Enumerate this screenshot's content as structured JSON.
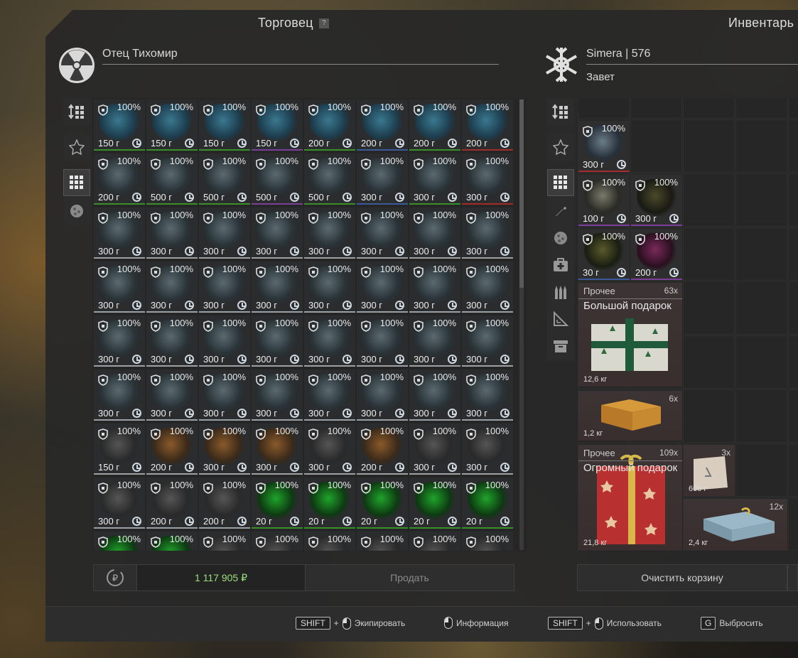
{
  "trader": {
    "section_title": "Торговец",
    "help": "?",
    "name": "Отец Тихомир",
    "icon": "radiation-icon"
  },
  "inventory": {
    "section_title": "Инвентарь",
    "player": "Simera | 576",
    "faction": "Завет",
    "icon": "faction-emblem-icon"
  },
  "trader_sidebar": [
    "sort-icon",
    "star-icon",
    "grid-icon",
    "artifact-icon"
  ],
  "inventory_sidebar": [
    "sort-icon",
    "star-icon",
    "grid-icon",
    "weapon-icon",
    "artifact-icon",
    "medkit-icon",
    "ammo-icon",
    "tools-icon",
    "box-icon"
  ],
  "colors": {
    "accent_green": "#9be07a",
    "rarity_green": "#3b8f2a",
    "rarity_purple": "#7b3f9a",
    "rarity_red": "#a22b2b",
    "rarity_blue": "#3a5a9a"
  },
  "trader_items": [
    [
      "100%",
      "150 г",
      "100%",
      "150 г",
      "100%",
      "150 г",
      "100%",
      "150 г",
      "100%",
      "200 г",
      "100%",
      "200 г",
      "100%",
      "200 г",
      "100%",
      "200 г"
    ],
    [
      "100%",
      "200 г",
      "100%",
      "500 г",
      "100%",
      "500 г",
      "100%",
      "500 г",
      "100%",
      "500 г",
      "100%",
      "300 г",
      "100%",
      "300 г",
      "100%",
      "300 г"
    ],
    [
      "100%",
      "300 г",
      "100%",
      "300 г",
      "100%",
      "300 г",
      "100%",
      "300 г",
      "100%",
      "300 г",
      "100%",
      "300 г",
      "100%",
      "300 г",
      "100%",
      "300 г"
    ],
    [
      "100%",
      "300 г",
      "100%",
      "300 г",
      "100%",
      "300 г",
      "100%",
      "300 г",
      "100%",
      "300 г",
      "100%",
      "300 г",
      "100%",
      "300 г",
      "100%",
      "300 г"
    ],
    [
      "100%",
      "300 г",
      "100%",
      "300 г",
      "100%",
      "300 г",
      "100%",
      "300 г",
      "100%",
      "300 г",
      "100%",
      "300 г",
      "100%",
      "300 г",
      "100%",
      "300 г"
    ],
    [
      "100%",
      "300 г",
      "100%",
      "300 г",
      "100%",
      "300 г",
      "100%",
      "300 г",
      "100%",
      "300 г",
      "100%",
      "300 г",
      "100%",
      "300 г",
      "100%",
      "300 г"
    ],
    [
      "100%",
      "150 г",
      "100%",
      "200 г",
      "100%",
      "300 г",
      "100%",
      "300 г",
      "100%",
      "300 г",
      "100%",
      "200 г",
      "100%",
      "300 г",
      "100%",
      "300 г"
    ],
    [
      "100%",
      "300 г",
      "100%",
      "200 г",
      "100%",
      "200 г",
      "100%",
      "20 г",
      "100%",
      "20 г",
      "100%",
      "20 г",
      "100%",
      "20 г",
      "100%",
      "20 г"
    ],
    [
      "100%",
      "",
      "100%",
      "",
      "100%",
      "",
      "100%",
      "",
      "100%",
      "",
      "100%",
      "",
      "100%",
      "",
      "100%",
      ""
    ]
  ],
  "inv_items": [
    {
      "pct": "100%",
      "price": "300 г"
    },
    {
      "pct": "100%",
      "price": "100 г"
    },
    {
      "pct": "100%",
      "price": "300 г"
    },
    {
      "pct": "100%",
      "price": "30 г"
    },
    {
      "pct": "100%",
      "price": "200 г"
    }
  ],
  "inv_big": [
    {
      "cat": "Прочее",
      "count": "63x",
      "title": "Большой подарок",
      "weight": "12,6 кг"
    },
    {
      "cat": "",
      "count": "6x",
      "title": "",
      "weight": "1,2 кг"
    },
    {
      "cat": "Прочее",
      "count": "109x",
      "title": "Огромный подарок",
      "weight": "21,8 кг"
    },
    {
      "cat": "",
      "count": "3x",
      "title": "",
      "weight": "600 г"
    },
    {
      "cat": "",
      "count": "12x",
      "title": "",
      "weight": "2,4 кг"
    }
  ],
  "footer": {
    "money": "1 117 905 ₽",
    "sell": "Продать",
    "clear": "Очистить корзину"
  },
  "hints": {
    "shift": "SHIFT",
    "plus": "+",
    "equip": "Экипировать",
    "info": "Информация",
    "use": "Использовать",
    "g_key": "G",
    "drop": "Выбросить"
  }
}
